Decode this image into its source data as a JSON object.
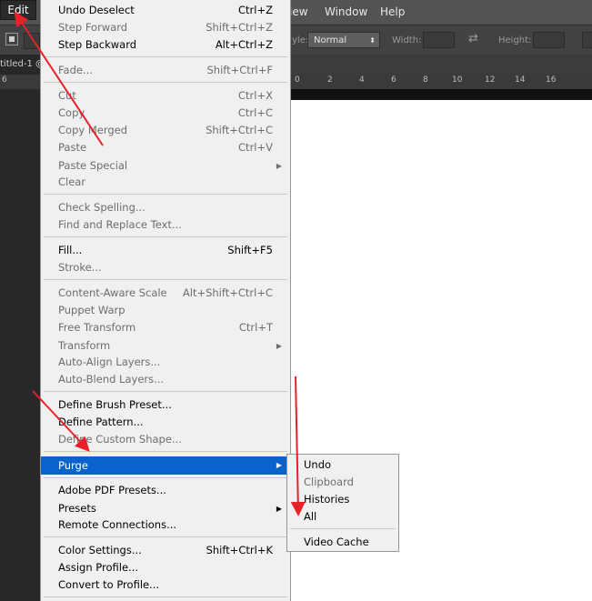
{
  "menubar": {
    "edit": "Edit",
    "view": "View",
    "window": "Window",
    "help": "Help"
  },
  "options": {
    "style_label": "yle:",
    "style_value": "Normal",
    "width_label": "Width:",
    "height_label": "Height:"
  },
  "document": {
    "tab_title": "titled-1 @"
  },
  "ruler": [
    "6",
    "0",
    "2",
    "4",
    "6",
    "8",
    "10",
    "12",
    "14",
    "16"
  ],
  "edit_menu": {
    "undo": {
      "label": "Undo Deselect",
      "shortcut": "Ctrl+Z"
    },
    "step_forward": {
      "label": "Step Forward",
      "shortcut": "Shift+Ctrl+Z"
    },
    "step_backward": {
      "label": "Step Backward",
      "shortcut": "Alt+Ctrl+Z"
    },
    "fade": {
      "label": "Fade...",
      "shortcut": "Shift+Ctrl+F"
    },
    "cut": {
      "label": "Cut",
      "shortcut": "Ctrl+X"
    },
    "copy": {
      "label": "Copy",
      "shortcut": "Ctrl+C"
    },
    "copy_merged": {
      "label": "Copy Merged",
      "shortcut": "Shift+Ctrl+C"
    },
    "paste": {
      "label": "Paste",
      "shortcut": "Ctrl+V"
    },
    "paste_special": {
      "label": "Paste Special"
    },
    "clear": {
      "label": "Clear"
    },
    "check_spelling": {
      "label": "Check Spelling..."
    },
    "find_replace": {
      "label": "Find and Replace Text..."
    },
    "fill": {
      "label": "Fill...",
      "shortcut": "Shift+F5"
    },
    "stroke": {
      "label": "Stroke..."
    },
    "content_aware_scale": {
      "label": "Content-Aware Scale",
      "shortcut": "Alt+Shift+Ctrl+C"
    },
    "puppet_warp": {
      "label": "Puppet Warp"
    },
    "free_transform": {
      "label": "Free Transform",
      "shortcut": "Ctrl+T"
    },
    "transform": {
      "label": "Transform"
    },
    "auto_align": {
      "label": "Auto-Align Layers..."
    },
    "auto_blend": {
      "label": "Auto-Blend Layers..."
    },
    "define_brush": {
      "label": "Define Brush Preset..."
    },
    "define_pattern": {
      "label": "Define Pattern..."
    },
    "define_shape": {
      "label": "Define Custom Shape..."
    },
    "purge": {
      "label": "Purge"
    },
    "adobe_pdf": {
      "label": "Adobe PDF Presets..."
    },
    "presets": {
      "label": "Presets"
    },
    "remote_connections": {
      "label": "Remote Connections..."
    },
    "color_settings": {
      "label": "Color Settings...",
      "shortcut": "Shift+Ctrl+K"
    },
    "assign_profile": {
      "label": "Assign Profile..."
    },
    "convert_profile": {
      "label": "Convert to Profile..."
    }
  },
  "purge_menu": {
    "undo": "Undo",
    "clipboard": "Clipboard",
    "histories": "Histories",
    "all": "All",
    "video_cache": "Video Cache"
  },
  "colors": {
    "highlight": "#0a63cc",
    "annotation_arrow": "#e8202a",
    "menu_background": "#f0f0f0"
  }
}
